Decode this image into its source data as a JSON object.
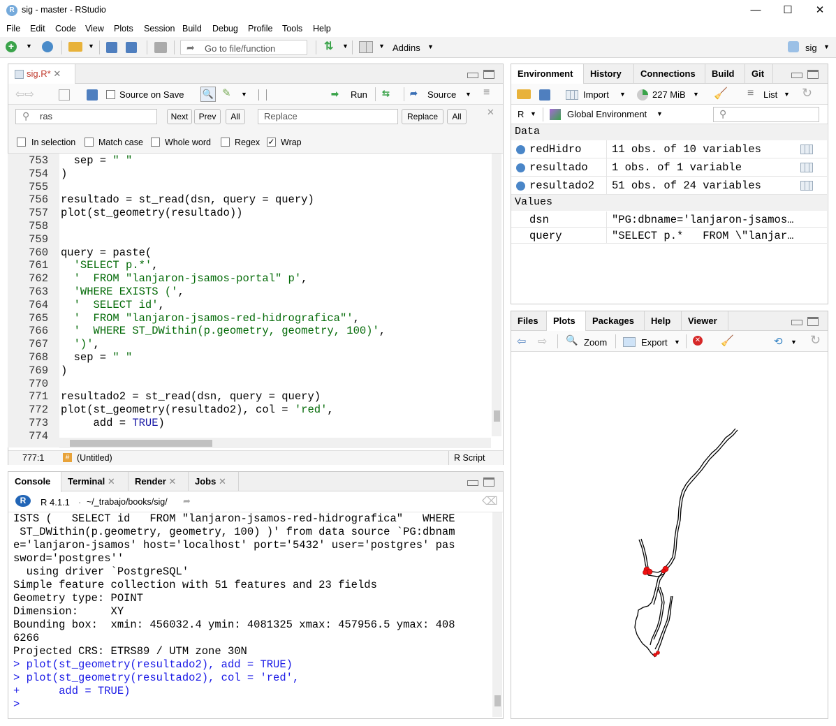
{
  "window": {
    "title": "sig - master - RStudio",
    "minimize": "—",
    "maximize": "☐",
    "close": "✕"
  },
  "menu": [
    "File",
    "Edit",
    "Code",
    "View",
    "Plots",
    "Session",
    "Build",
    "Debug",
    "Profile",
    "Tools",
    "Help"
  ],
  "toolbar": {
    "goto_placeholder": "Go to file/function",
    "addins": "Addins",
    "project": "sig"
  },
  "editor": {
    "tab": "sig.R*",
    "source_on_save": "Source on Save",
    "run": "Run",
    "source": "Source",
    "find": {
      "search_value": "ras",
      "next": "Next",
      "prev": "Prev",
      "all": "All",
      "replace_placeholder": "Replace",
      "replace": "Replace",
      "replace_all": "All"
    },
    "options": {
      "in_selection": "In selection",
      "match_case": "Match case",
      "whole_word": "Whole word",
      "regex": "Regex",
      "wrap": "Wrap"
    },
    "lines": [
      {
        "n": "753",
        "t": "  sep = \" \""
      },
      {
        "n": "754",
        "t": ")"
      },
      {
        "n": "755",
        "t": ""
      },
      {
        "n": "756",
        "t": "resultado = st_read(dsn, query = query)"
      },
      {
        "n": "757",
        "t": "plot(st_geometry(resultado))"
      },
      {
        "n": "758",
        "t": ""
      },
      {
        "n": "759",
        "t": ""
      },
      {
        "n": "760",
        "t": "query = paste("
      },
      {
        "n": "761",
        "t": "  'SELECT p.*',"
      },
      {
        "n": "762",
        "t": "  '  FROM \"lanjaron-jsamos-portal\" p',"
      },
      {
        "n": "763",
        "t": "  'WHERE EXISTS (',"
      },
      {
        "n": "764",
        "t": "  '  SELECT id',"
      },
      {
        "n": "765",
        "t": "  '  FROM \"lanjaron-jsamos-red-hidrografica\"',"
      },
      {
        "n": "766",
        "t": "  '  WHERE ST_DWithin(p.geometry, geometry, 100)',"
      },
      {
        "n": "767",
        "t": "  ')',"
      },
      {
        "n": "768",
        "t": "  sep = \" \""
      },
      {
        "n": "769",
        "t": ")"
      },
      {
        "n": "770",
        "t": ""
      },
      {
        "n": "771",
        "t": "resultado2 = st_read(dsn, query = query)"
      },
      {
        "n": "772",
        "t": "plot(st_geometry(resultado2), col = 'red',"
      },
      {
        "n": "773",
        "t": "     add = TRUE)"
      },
      {
        "n": "774",
        "t": ""
      }
    ],
    "status": {
      "position": "777:1",
      "scope": "(Untitled)",
      "filetype": "R Script"
    }
  },
  "console": {
    "tabs": [
      "Console",
      "Terminal",
      "Render",
      "Jobs"
    ],
    "r_version": "R 4.1.1",
    "path": "~/_trabajo/books/sig/",
    "output": [
      "ISTS (   SELECT id   FROM \"lanjaron-jsamos-red-hidrografica\"   WHERE",
      " ST_DWithin(p.geometry, geometry, 100) )' from data source `PG:dbnam",
      "e='lanjaron-jsamos' host='localhost' port='5432' user='postgres' pas",
      "sword='postgres''",
      "  using driver `PostgreSQL'",
      "Simple feature collection with 51 features and 23 fields",
      "Geometry type: POINT",
      "Dimension:     XY",
      "Bounding box:  xmin: 456032.4 ymin: 4081325 xmax: 457956.5 ymax: 408",
      "6266",
      "Projected CRS: ETRS89 / UTM zone 30N"
    ],
    "commands": [
      "> plot(st_geometry(resultado2), add = TRUE)",
      "> plot(st_geometry(resultado2), col = 'red',",
      "+      add = TRUE)",
      "> "
    ]
  },
  "environment": {
    "tabs": [
      "Environment",
      "History",
      "Connections",
      "Build",
      "Git"
    ],
    "import": "Import",
    "memory": "227 MiB",
    "view": "List",
    "language": "R",
    "scope": "Global Environment",
    "data_header": "Data",
    "data": [
      {
        "name": "redHidro",
        "value": "11 obs. of 10 variables"
      },
      {
        "name": "resultado",
        "value": "1 obs. of 1 variable"
      },
      {
        "name": "resultado2",
        "value": "51 obs. of 24 variables"
      }
    ],
    "values_header": "Values",
    "values": [
      {
        "name": "dsn",
        "value": "\"PG:dbname='lanjaron-jsamos…"
      },
      {
        "name": "query",
        "value": "\"SELECT p.*   FROM \\\"lanjar…"
      }
    ]
  },
  "files": {
    "tabs": [
      "Files",
      "Plots",
      "Packages",
      "Help",
      "Viewer"
    ],
    "zoom": "Zoom",
    "export": "Export"
  }
}
